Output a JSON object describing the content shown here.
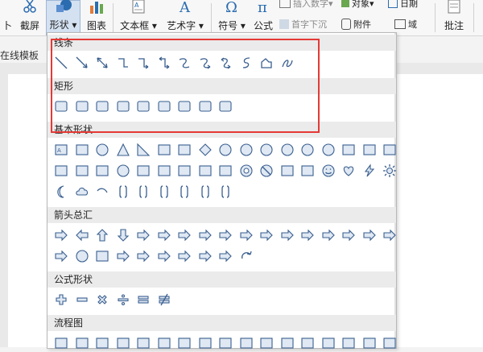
{
  "ribbon": {
    "screenshot_label": "截屏",
    "shape_label": "形状",
    "chart_label": "图表",
    "textbox_label": "文本框",
    "wordart_label": "艺术字",
    "symbol_label": "符号",
    "formula_label": "公式",
    "insert_number_label": "插入数字",
    "object_label": "对象",
    "date_label": "日期",
    "drop_cap_label": "首字下沉",
    "attachment_label": "附件",
    "field_label": "域",
    "comment_label": "批注",
    "accent_color": "#2b6cb0"
  },
  "left_tab_label": "在线模板",
  "shape_panel": {
    "sections": [
      {
        "title": "线条",
        "rows": [
          [
            "line",
            "arrow",
            "double-arrow",
            "elbow",
            "elbow-arrow",
            "elbow-double-arrow",
            "curve",
            "curve-arrow",
            "curve-double-arrow",
            "s-curve",
            "freeform",
            "scribble"
          ]
        ]
      },
      {
        "title": "矩形",
        "rows": [
          [
            "rect",
            "round-rect",
            "snip-one",
            "snip-two",
            "snip-round",
            "round-one",
            "round-two-same",
            "round-two-diag",
            "rect-alt"
          ]
        ]
      },
      {
        "title": "基本形状",
        "rows": [
          [
            "textbox",
            "vertical-textbox",
            "oval",
            "triangle",
            "right-triangle",
            "parallelogram",
            "trapezoid",
            "diamond",
            "pentagon",
            "hexagon",
            "heptagon",
            "octagon",
            "decagon",
            "dodecagon",
            "pie",
            "teardrop",
            "chord"
          ],
          [
            "frame",
            "half-frame",
            "l-shape",
            "diagonal-stripe",
            "cross",
            "plaque",
            "can",
            "cube",
            "bevel",
            "donut",
            "no-symbol",
            "block-arc",
            "folded-corner",
            "smiley",
            "heart",
            "lightning",
            "sun"
          ],
          [
            "moon",
            "cloud",
            "arc",
            "double-bracket",
            "double-brace",
            "left-bracket",
            "right-bracket",
            "left-brace",
            "right-brace"
          ]
        ]
      },
      {
        "title": "箭头总汇",
        "rows": [
          [
            "right-arrow",
            "left-arrow",
            "up-arrow",
            "down-arrow",
            "left-right-arrow",
            "up-down-arrow",
            "quad-arrow",
            "left-right-up-arrow",
            "bent-arrow",
            "u-turn-arrow",
            "left-up-arrow",
            "bent-up-arrow",
            "curved-right-arrow",
            "curved-left-arrow",
            "curved-up-arrow",
            "curved-down-arrow",
            "striped-right-arrow"
          ],
          [
            "notched-right-arrow",
            "pentagon-arrow",
            "chevron",
            "right-arrow-callout",
            "left-arrow-callout",
            "up-arrow-callout",
            "down-arrow-callout",
            "left-right-arrow-callout",
            "quad-arrow-callout",
            "circular-arrow"
          ]
        ]
      },
      {
        "title": "公式形状",
        "rows": [
          [
            "plus",
            "minus",
            "multiply",
            "divide",
            "equal",
            "not-equal"
          ]
        ]
      },
      {
        "title": "流程图",
        "rows": [
          [
            "process",
            "alt-process",
            "decision",
            "data",
            "predefined",
            "internal-storage",
            "document",
            "multidoc",
            "terminator",
            "preparation",
            "manual-input",
            "manual-op",
            "connector",
            "offpage",
            "card",
            "punched-tape",
            "summing-junction"
          ]
        ]
      }
    ]
  }
}
